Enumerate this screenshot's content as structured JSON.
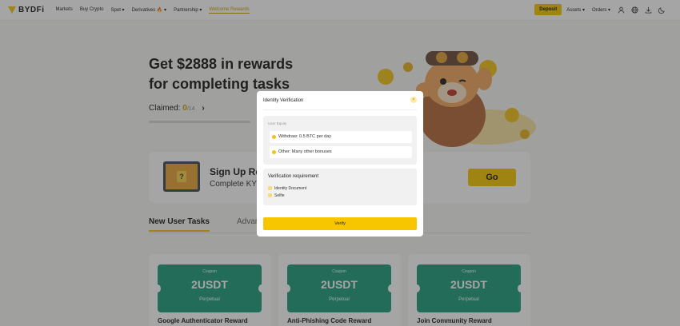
{
  "nav": {
    "logo_text": "BYDFi",
    "links": [
      "Markets",
      "Buy Crypto",
      "Spot ▾",
      "Derivatives 🔥 ▾",
      "Partnership ▾",
      "Welcome Rewards"
    ],
    "deposit_label": "Deposit",
    "assets_label": "Assets ▾",
    "orders_label": "Orders ▾",
    "icons": [
      "user-icon",
      "globe-icon",
      "download-icon",
      "moon-icon"
    ]
  },
  "hero": {
    "title_line1": "Get $2888 in rewards",
    "title_line2": "for completing tasks",
    "claimed_label": "Claimed:",
    "claimed_count": "0",
    "claimed_total": "/14",
    "chevron": "›",
    "progress_fraction": 0.0
  },
  "signup": {
    "title": "Sign Up Re",
    "subtitle": "Complete KYC",
    "go_label": "Go"
  },
  "tabs": [
    "New User Tasks",
    "Advan"
  ],
  "rewards": [
    {
      "coupon_type": "Coupon",
      "value": "2USDT",
      "duration": "Perpetual",
      "title": "Google Authenticator Reward"
    },
    {
      "coupon_type": "Coupon",
      "value": "2USDT",
      "duration": "Perpetual",
      "title": "Anti-Phishing Code Reward"
    },
    {
      "coupon_type": "Coupon",
      "value": "2USDT",
      "duration": "Perpetual",
      "title": "Join Community Reward"
    }
  ],
  "modal": {
    "title": "Identity Verification",
    "close_symbol": "×",
    "equity_label": "User Equity",
    "equity_items": [
      "Withdraw: 0.5 BTC per day",
      "Other: Many other bonuses"
    ],
    "requirement_title": "Verification requirement",
    "requirements": [
      "Identity Document",
      "Selfie"
    ],
    "verify_label": "Verify"
  }
}
